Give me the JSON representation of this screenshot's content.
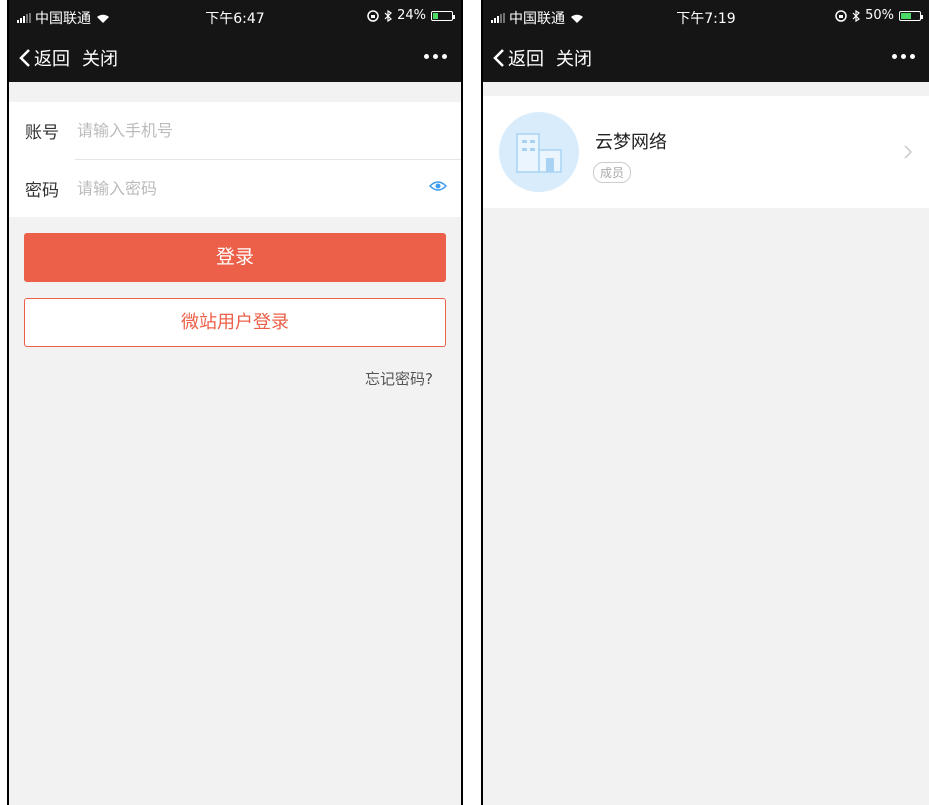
{
  "left": {
    "status": {
      "carrier": "中国联通",
      "time": "下午6:47",
      "battery": "24%",
      "battery_level": 0.24
    },
    "nav": {
      "back_label": "返回",
      "close_label": "关闭"
    },
    "form": {
      "account_label": "账号",
      "account_placeholder": "请输入手机号",
      "password_label": "密码",
      "password_placeholder": "请输入密码"
    },
    "buttons": {
      "login_label": "登录",
      "weizhan_label": "微站用户登录"
    },
    "forgot_label": "忘记密码?"
  },
  "right": {
    "status": {
      "carrier": "中国联通",
      "time": "下午7:19",
      "battery": "50%",
      "battery_level": 0.5
    },
    "nav": {
      "back_label": "返回",
      "close_label": "关闭"
    },
    "org": {
      "name": "云梦网络",
      "role_badge": "成员"
    }
  },
  "icons": {
    "signal": "signal-icon",
    "wifi": "wifi-icon",
    "lock_rotation": "orientation-lock-icon",
    "bluetooth": "bluetooth-icon",
    "battery": "battery-icon",
    "back": "chevron-left-icon",
    "more": "more-icon",
    "eye": "eye-icon",
    "building": "building-icon",
    "chevron_right": "chevron-right-icon"
  },
  "colors": {
    "navbar": "#151515",
    "accent": "#ec6049",
    "eye": "#3d9cf0",
    "avatar_bg": "#d8ecfb"
  }
}
